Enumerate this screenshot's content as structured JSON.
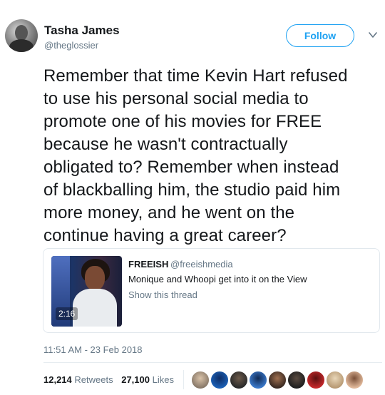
{
  "author": {
    "name": "Tasha James",
    "handle": "@theglossier"
  },
  "follow_button": {
    "label": "Follow"
  },
  "more_icon": "chevron-down-icon",
  "tweet": {
    "text": "Remember that time Kevin Hart refused\nto use his personal social media to\npromote one of his movies for FREE\nbecause he wasn't contractually\nobligated to? Remember when instead\nof blackballing him, the studio paid him\nmore money, and he went on the\ncontinue having a great career?"
  },
  "quoted": {
    "name": "FREEISH",
    "handle": "@freeishmedia",
    "text": "Monique and Whoopi get into it on the View",
    "show_thread": "Show this thread",
    "video_duration": "2:16"
  },
  "timestamp": "11:51 AM - 23 Feb 2018",
  "stats": {
    "retweets_count": "12,214",
    "retweets_label": "Retweets",
    "likes_count": "27,100",
    "likes_label": "Likes"
  },
  "likers": [
    {
      "color": "#8a7a6a",
      "accent": "#d9c2a8"
    },
    {
      "color": "#1b5fb4",
      "accent": "#0e2d66"
    },
    {
      "color": "#2a2a2a",
      "accent": "#6d5a4a"
    },
    {
      "color": "#3a78c9",
      "accent": "#102a55"
    },
    {
      "color": "#3b2a22",
      "accent": "#a07050"
    },
    {
      "color": "#1f1f1f",
      "accent": "#5a4a40"
    },
    {
      "color": "#c4282a",
      "accent": "#5a1010"
    },
    {
      "color": "#b89a74",
      "accent": "#e8d6b8"
    },
    {
      "color": "#e0b89a",
      "accent": "#7a5038"
    }
  ],
  "colors": {
    "accent": "#1da1f2",
    "secondary_text": "#657786",
    "primary_text": "#14171a"
  }
}
